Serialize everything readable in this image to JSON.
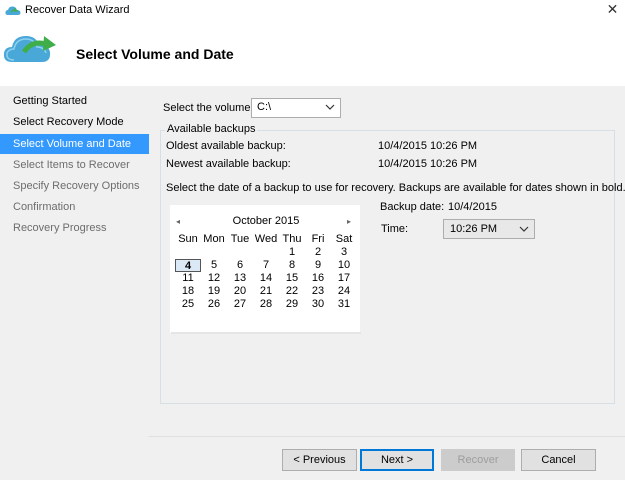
{
  "window": {
    "title": "Recover Data Wizard",
    "close_glyph": "✕",
    "app_icon": "cloud-restore-icon"
  },
  "header": {
    "title": "Select Volume and Date",
    "icon": "cloud-restore-icon"
  },
  "sidebar": {
    "items": [
      {
        "label": "Getting Started",
        "state": "done"
      },
      {
        "label": "Select Recovery Mode",
        "state": "done"
      },
      {
        "label": "Select Volume and Date",
        "state": "active"
      },
      {
        "label": "Select Items to Recover",
        "state": "pending"
      },
      {
        "label": "Specify Recovery Options",
        "state": "pending"
      },
      {
        "label": "Confirmation",
        "state": "pending"
      },
      {
        "label": "Recovery Progress",
        "state": "pending"
      }
    ]
  },
  "volume": {
    "label": "Select the volume:",
    "value": "C:\\"
  },
  "backups": {
    "group_title": "Available backups",
    "oldest_label": "Oldest available backup:",
    "oldest_value": "10/4/2015 10:26 PM",
    "newest_label": "Newest available backup:",
    "newest_value": "10/4/2015 10:26 PM",
    "instruction": "Select the date of a backup to use for recovery. Backups are available for dates shown in bold."
  },
  "calendar": {
    "month_label": "October 2015",
    "prev_glyph": "◂",
    "next_glyph": "▸",
    "weekdays": [
      "Sun",
      "Mon",
      "Tue",
      "Wed",
      "Thu",
      "Fri",
      "Sat"
    ],
    "weeks": [
      [
        "",
        "",
        "",
        "",
        "1",
        "2",
        "3"
      ],
      [
        "4",
        "5",
        "6",
        "7",
        "8",
        "9",
        "10"
      ],
      [
        "11",
        "12",
        "13",
        "14",
        "15",
        "16",
        "17"
      ],
      [
        "18",
        "19",
        "20",
        "21",
        "22",
        "23",
        "24"
      ],
      [
        "25",
        "26",
        "27",
        "28",
        "29",
        "30",
        "31"
      ]
    ],
    "selected_day": "4",
    "bold_days": [
      "4"
    ]
  },
  "backup_date": {
    "label": "Backup date:",
    "value": "10/4/2015"
  },
  "time": {
    "label": "Time:",
    "value": "10:26 PM"
  },
  "buttons": {
    "previous": "< Previous",
    "next": "Next >",
    "recover": "Recover",
    "cancel": "Cancel"
  },
  "colors": {
    "active_step_bg": "#3399ff",
    "primary_button_border": "#0078d7",
    "cloud_blue": "#4aa8d8",
    "arrow_green": "#3fae49"
  }
}
